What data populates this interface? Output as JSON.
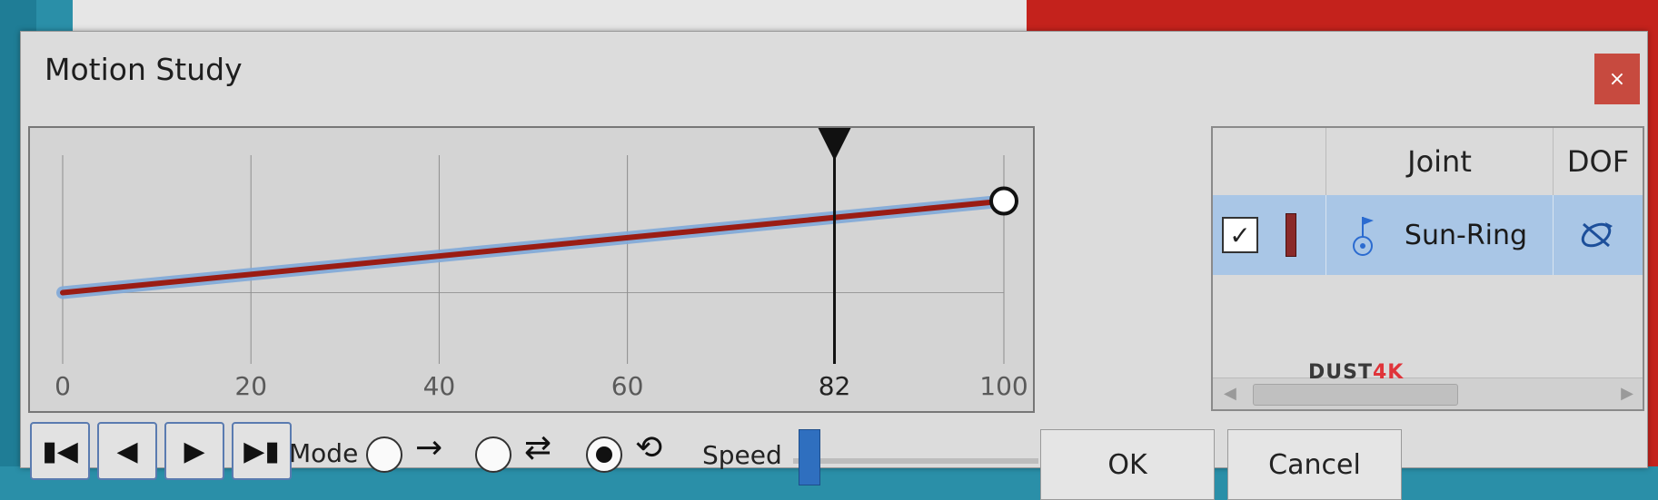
{
  "window": {
    "title": "Motion Study",
    "close_glyph": "×"
  },
  "chart_data": {
    "type": "line",
    "series": [
      {
        "x": [
          0,
          100
        ],
        "y": [
          0,
          1
        ]
      }
    ],
    "x_ticks": [
      "0",
      "20",
      "40",
      "60",
      "82",
      "100"
    ],
    "xlim": [
      0,
      100
    ],
    "ylim": [
      -0.5,
      1.5
    ],
    "playhead": 82,
    "line_color": "#9a1c14",
    "highlight_color": "#7fa9d8"
  },
  "joints_table": {
    "columns": [
      "",
      "Joint",
      "DOF"
    ],
    "rows": [
      {
        "checked": "✓",
        "joint_icon": "joint-pin-icon",
        "joint": "Sun-Ring",
        "dof_icon": "dof-rotation-icon"
      }
    ]
  },
  "playback": {
    "buttons": [
      {
        "name": "go-to-start-button",
        "glyph": "▮◀"
      },
      {
        "name": "step-back-button",
        "glyph": "◀"
      },
      {
        "name": "step-forward-button",
        "glyph": "▶"
      },
      {
        "name": "go-to-end-button",
        "glyph": "▶▮"
      }
    ],
    "mode_label": "Mode",
    "modes": [
      {
        "glyph": "→",
        "selected": false
      },
      {
        "glyph": "⇄",
        "selected": false
      },
      {
        "glyph": "⟲",
        "selected": true
      }
    ],
    "speed_label": "Speed"
  },
  "dialog_buttons": {
    "ok": "OK",
    "cancel": "Cancel"
  },
  "watermark": {
    "prefix": "DUST",
    "suffix": "4K"
  }
}
